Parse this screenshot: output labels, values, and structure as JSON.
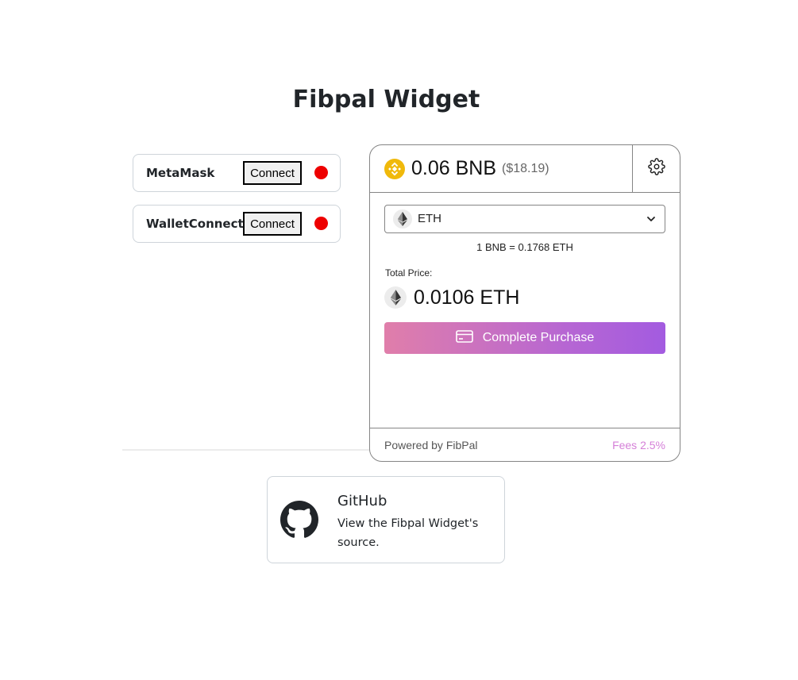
{
  "page": {
    "title": "Fibpal Widget"
  },
  "wallets": [
    {
      "name": "MetaMask",
      "connect_label": "Connect",
      "status_color": "#ee0000"
    },
    {
      "name": "WalletConnect",
      "connect_label": "Connect",
      "status_color": "#ee0000"
    }
  ],
  "widget": {
    "balance": {
      "amount": "0.06 BNB",
      "usd": "($18.19)",
      "token_icon": "bnb-icon"
    },
    "settings_icon": "gear-icon",
    "token_select": {
      "selected": "ETH",
      "icon": "eth-icon"
    },
    "rate": "1 BNB = 0.1768 ETH",
    "total_label": "Total Price:",
    "total_amount": "0.0106 ETH",
    "purchase_button": {
      "label": "Complete Purchase",
      "icon": "credit-card-icon",
      "gradient": [
        "#e07eaa",
        "#a35be0"
      ]
    },
    "footer": {
      "powered_by": "Powered by FibPal",
      "fees": "Fees 2.5%",
      "fees_color": "#d57fd8"
    }
  },
  "github_card": {
    "title": "GitHub",
    "description": "View the Fibpal Widget's source.",
    "icon": "github-icon"
  }
}
